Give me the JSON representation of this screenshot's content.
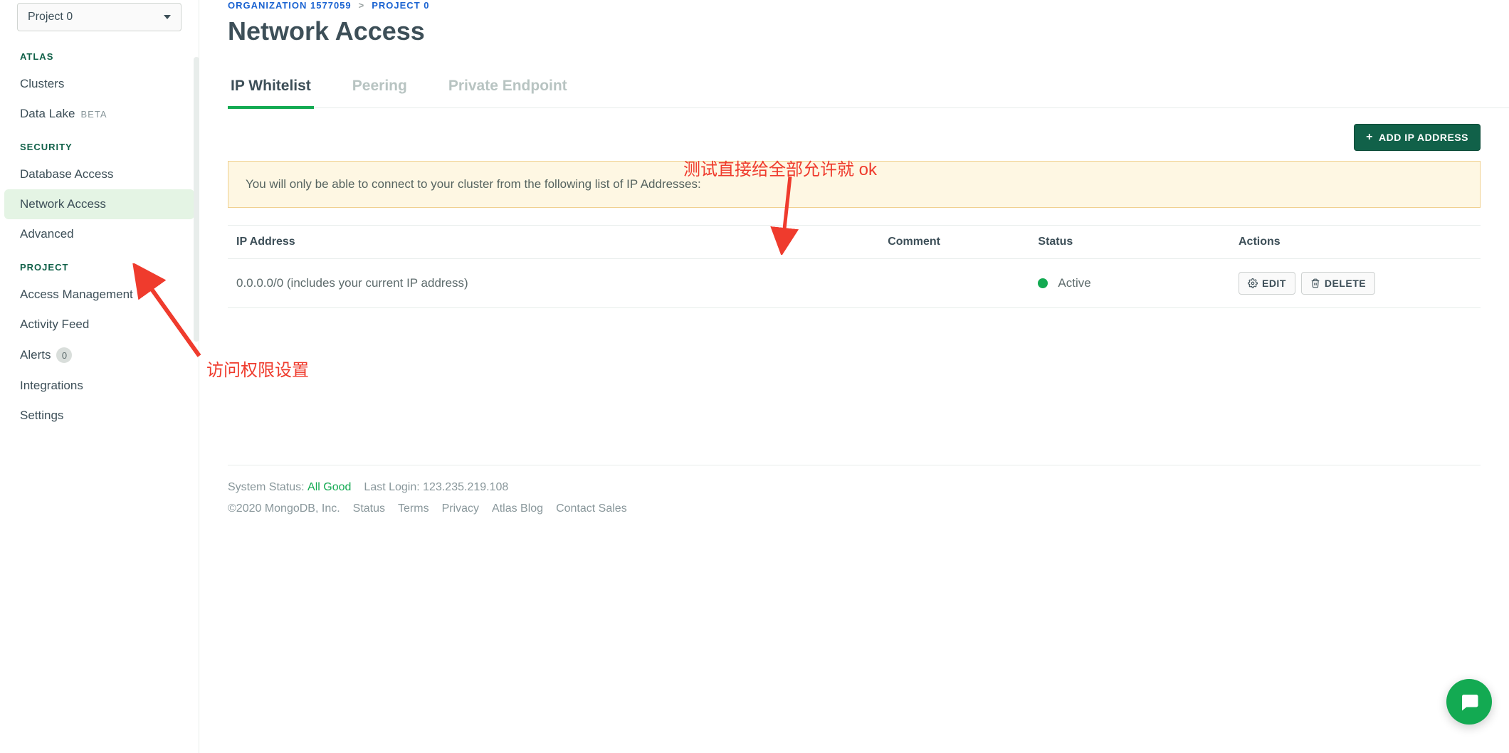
{
  "sidebar": {
    "project_selector": "Project 0",
    "sections": {
      "atlas": {
        "heading": "ATLAS",
        "items": [
          "Clusters",
          "Data Lake"
        ],
        "beta_label": "BETA"
      },
      "security": {
        "heading": "SECURITY",
        "items": [
          "Database Access",
          "Network Access",
          "Advanced"
        ]
      },
      "project": {
        "heading": "PROJECT",
        "items": [
          "Access Management",
          "Activity Feed",
          "Alerts",
          "Integrations",
          "Settings"
        ],
        "alerts_count": "0"
      }
    }
  },
  "breadcrumb": {
    "org": "ORGANIZATION 1577059",
    "sep": ">",
    "project": "PROJECT 0"
  },
  "page_title": "Network Access",
  "tabs": [
    "IP Whitelist",
    "Peering",
    "Private Endpoint"
  ],
  "add_button": "ADD IP ADDRESS",
  "banner": "You will only be able to connect to your cluster from the following list of IP Addresses:",
  "table": {
    "headers": [
      "IP Address",
      "Comment",
      "Status",
      "Actions"
    ],
    "rows": [
      {
        "ip": "0.0.0.0/0  (includes your current IP address)",
        "comment": "",
        "status": "Active",
        "edit_label": "EDIT",
        "delete_label": "DELETE"
      }
    ]
  },
  "footer": {
    "status_label": "System Status:",
    "status_value": "All Good",
    "last_login_label": "Last Login:",
    "last_login_value": "123.235.219.108",
    "copyright": "©2020 MongoDB, Inc.",
    "links": [
      "Status",
      "Terms",
      "Privacy",
      "Atlas Blog",
      "Contact Sales"
    ]
  },
  "annotations": {
    "top": "测试直接给全部允许就 ok",
    "side": "访问权限设置"
  }
}
